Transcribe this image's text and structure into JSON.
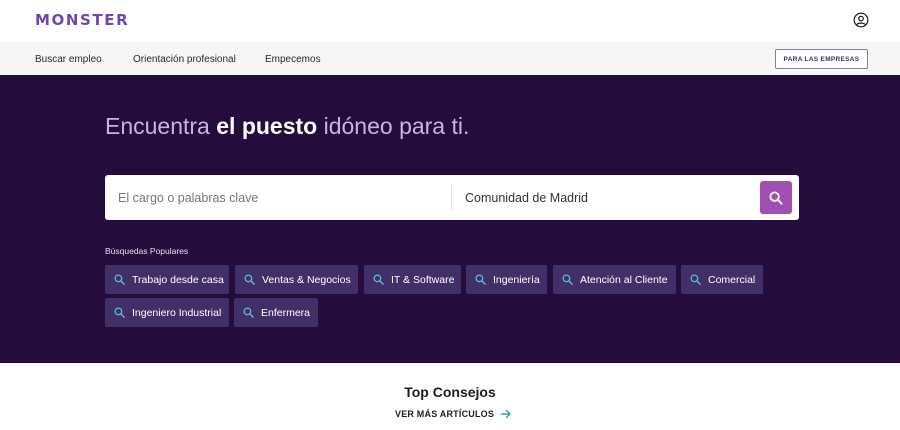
{
  "header": {
    "logo": "MONSTER",
    "account_icon": "user-circle-icon"
  },
  "nav": {
    "links": [
      "Buscar empleo",
      "Orientación profesional",
      "Empecemos"
    ],
    "business_button": "PARA LAS EMPRESAS"
  },
  "hero": {
    "title_part1": "Encuentra ",
    "title_emphasis": "el puesto",
    "title_part2": " idóneo para ti.",
    "search": {
      "keywords_placeholder": "El cargo o palabras clave",
      "location_value": "Comunidad de Madrid",
      "button_icon": "search-icon"
    },
    "popular_label": "Búsquedas Populares",
    "popular_searches": [
      "Trabajo desde casa",
      "Ventas & Negocios",
      "IT & Software",
      "Ingeniería",
      "Atención al Cliente",
      "Comercial",
      "Ingeniero Industrial",
      "Enfermera"
    ]
  },
  "tips": {
    "title": "Top Consejos",
    "link": "VER MÁS ARTÍCULOS",
    "link_icon": "arrow-right-icon"
  },
  "colors": {
    "brand": "#6e46ae",
    "hero_bg": "#240d3c",
    "chip_bg": "#413067",
    "search_button": "#a14fb1",
    "chip_icon": "#5fb8d8",
    "arrow": "#2aa6a0"
  }
}
